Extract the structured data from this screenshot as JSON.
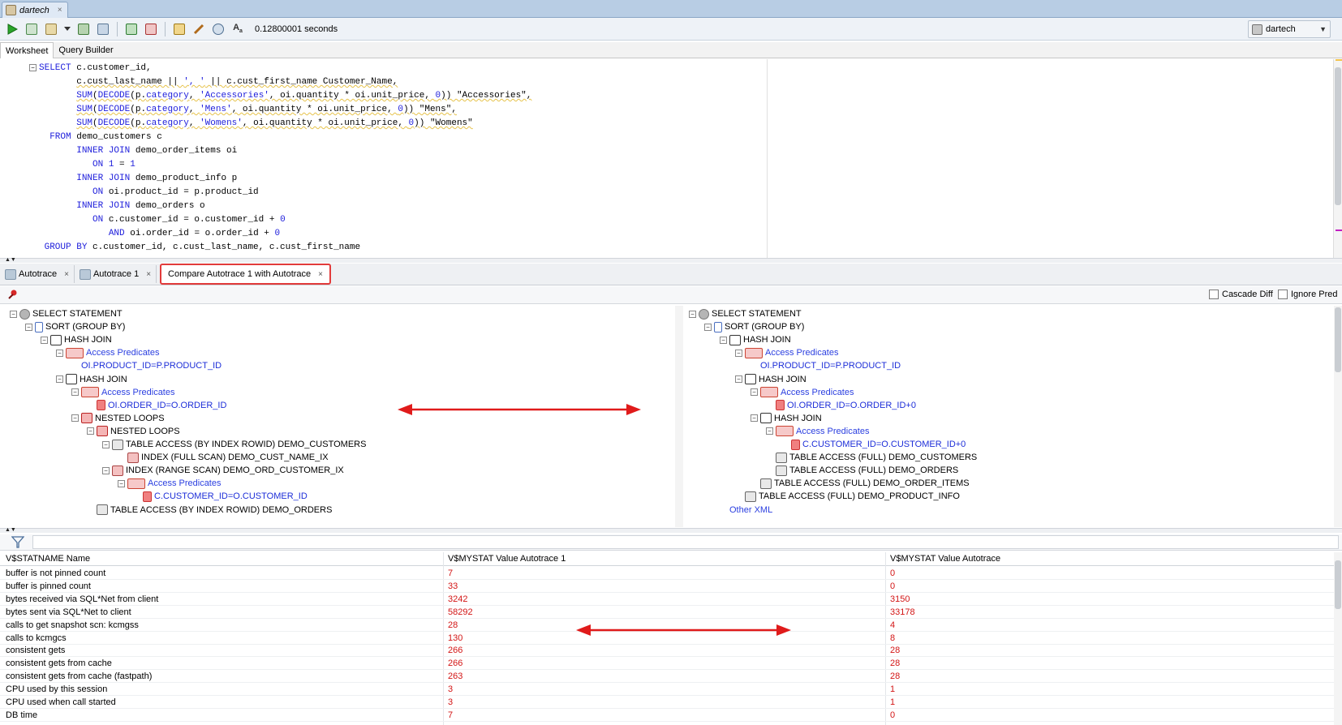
{
  "window": {
    "tab_title": "dartech",
    "tab_close": "×"
  },
  "toolbar": {
    "timing": "0.12800001 seconds",
    "connection": "dartech",
    "icons": [
      "run-statement-icon",
      "run-script-icon",
      "commit-icon",
      "rollback-icon",
      "autotrace-icon",
      "explain-plan-icon",
      "sql-tuning-icon",
      "clear-icon",
      "history-icon",
      "format-icon"
    ]
  },
  "worksheet_tabs": [
    "Worksheet",
    "Query Builder"
  ],
  "editor": {
    "lines": [
      {
        "indent": "",
        "parts": [
          [
            "kw",
            "SELECT"
          ],
          [
            "t",
            " c.customer_id,"
          ]
        ]
      },
      {
        "indent": "       ",
        "parts": [
          [
            "t",
            "c.cust_last_name || "
          ],
          [
            "str",
            "', '"
          ],
          [
            "t",
            " || "
          ],
          [
            "t",
            "c.cust_first_name Customer_Name,"
          ]
        ]
      },
      {
        "indent": "       ",
        "parts": [
          [
            "kw",
            "SUM"
          ],
          [
            "t",
            "("
          ],
          [
            "kw",
            "DECODE"
          ],
          [
            "t",
            "(p."
          ],
          [
            "kw",
            "category"
          ],
          [
            "t",
            ", "
          ],
          [
            "str",
            "'Accessories'"
          ],
          [
            "t",
            ", oi.quantity * oi.unit_price, "
          ],
          [
            "num",
            "0"
          ],
          [
            "t",
            ")) \"Accessories\","
          ]
        ]
      },
      {
        "indent": "       ",
        "parts": [
          [
            "kw",
            "SUM"
          ],
          [
            "t",
            "("
          ],
          [
            "kw",
            "DECODE"
          ],
          [
            "t",
            "(p."
          ],
          [
            "kw",
            "category"
          ],
          [
            "t",
            ", "
          ],
          [
            "str",
            "'Mens'"
          ],
          [
            "t",
            ", oi.quantity * oi.unit_price, "
          ],
          [
            "num",
            "0"
          ],
          [
            "t",
            ")) \"Mens\","
          ]
        ]
      },
      {
        "indent": "       ",
        "parts": [
          [
            "kw",
            "SUM"
          ],
          [
            "t",
            "("
          ],
          [
            "kw",
            "DECODE"
          ],
          [
            "t",
            "(p."
          ],
          [
            "kw",
            "category"
          ],
          [
            "t",
            ", "
          ],
          [
            "str",
            "'Womens'"
          ],
          [
            "t",
            ", oi.quantity * oi.unit_price, "
          ],
          [
            "num",
            "0"
          ],
          [
            "t",
            ")) \"Womens\""
          ]
        ]
      },
      {
        "indent": "  ",
        "parts": [
          [
            "kw",
            "FROM"
          ],
          [
            "t",
            " demo_customers c"
          ]
        ]
      },
      {
        "indent": "       ",
        "parts": [
          [
            "kw",
            "INNER JOIN"
          ],
          [
            "t",
            " demo_order_items oi"
          ]
        ]
      },
      {
        "indent": "          ",
        "parts": [
          [
            "kw",
            "ON"
          ],
          [
            "t",
            " "
          ],
          [
            "num",
            "1"
          ],
          [
            "t",
            " = "
          ],
          [
            "num",
            "1"
          ]
        ]
      },
      {
        "indent": "       ",
        "parts": [
          [
            "kw",
            "INNER JOIN"
          ],
          [
            "t",
            " demo_product_info p"
          ]
        ]
      },
      {
        "indent": "          ",
        "parts": [
          [
            "kw",
            "ON"
          ],
          [
            "t",
            " oi.product_id = p.product_id"
          ]
        ]
      },
      {
        "indent": "       ",
        "parts": [
          [
            "kw",
            "INNER JOIN"
          ],
          [
            "t",
            " demo_orders o"
          ]
        ]
      },
      {
        "indent": "          ",
        "parts": [
          [
            "kw",
            "ON"
          ],
          [
            "t",
            " c.customer_id = o.customer_id + "
          ],
          [
            "num",
            "0"
          ]
        ]
      },
      {
        "indent": "             ",
        "parts": [
          [
            "kw",
            "AND"
          ],
          [
            "t",
            " oi.order_id = o.order_id + "
          ],
          [
            "num",
            "0"
          ]
        ]
      },
      {
        "indent": " ",
        "parts": [
          [
            "kw",
            "GROUP BY"
          ],
          [
            "t",
            " c.customer_id, c.cust_last_name, c.cust_first_name"
          ]
        ]
      }
    ]
  },
  "result_tabs": [
    {
      "label": "Autotrace",
      "close": "×"
    },
    {
      "label": "Autotrace 1",
      "close": "×"
    },
    {
      "label": "Compare Autotrace 1 with Autotrace",
      "close": "×"
    }
  ],
  "options": {
    "cascade_diff": "Cascade Diff",
    "ignore_pred": "Ignore Pred"
  },
  "left_tree": [
    {
      "d": 0,
      "label": "SELECT STATEMENT",
      "icon": "select-statement-icon",
      "tog": "⊟"
    },
    {
      "d": 1,
      "label": "SORT (GROUP BY)",
      "icon": "sort-icon",
      "tog": "⊟"
    },
    {
      "d": 2,
      "label": "HASH JOIN",
      "icon": "hash-join-icon",
      "tog": "⊟"
    },
    {
      "d": 3,
      "label": "Access Predicates",
      "icon": "access-predicates-icon",
      "tog": "⊟",
      "cls": "pred"
    },
    {
      "d": 4,
      "label": "OI.PRODUCT_ID=P.PRODUCT_ID",
      "icon": "",
      "cls": "blue"
    },
    {
      "d": 3,
      "label": "HASH JOIN",
      "icon": "hash-join-icon",
      "tog": "⊟"
    },
    {
      "d": 4,
      "label": "Access Predicates",
      "icon": "access-predicates-icon",
      "tog": "⊟",
      "cls": "pred"
    },
    {
      "d": 5,
      "label": "OI.ORDER_ID=O.ORDER_ID",
      "icon": "predicate-icon",
      "cls": "blue"
    },
    {
      "d": 4,
      "label": "NESTED LOOPS",
      "icon": "nested-loops-icon",
      "tog": "⊟"
    },
    {
      "d": 5,
      "label": "NESTED LOOPS",
      "icon": "nested-loops-icon",
      "tog": "⊟"
    },
    {
      "d": 6,
      "label": "TABLE ACCESS (BY INDEX ROWID) DEMO_CUSTOMERS",
      "icon": "table-icon",
      "tog": "⊟"
    },
    {
      "d": 7,
      "label": "INDEX (FULL SCAN) DEMO_CUST_NAME_IX",
      "icon": "index-icon"
    },
    {
      "d": 6,
      "label": "INDEX (RANGE SCAN) DEMO_ORD_CUSTOMER_IX",
      "icon": "index-icon",
      "tog": "⊟"
    },
    {
      "d": 7,
      "label": "Access Predicates",
      "icon": "access-predicates-icon",
      "tog": "⊟",
      "cls": "pred"
    },
    {
      "d": 8,
      "label": "C.CUSTOMER_ID=O.CUSTOMER_ID",
      "icon": "predicate-icon",
      "cls": "blue"
    },
    {
      "d": 5,
      "label": "TABLE ACCESS (BY INDEX ROWID) DEMO_ORDERS",
      "icon": "table-icon"
    }
  ],
  "right_tree": [
    {
      "d": 0,
      "label": "SELECT STATEMENT",
      "icon": "select-statement-icon",
      "tog": "⊟"
    },
    {
      "d": 1,
      "label": "SORT (GROUP BY)",
      "icon": "sort-icon",
      "tog": "⊟"
    },
    {
      "d": 2,
      "label": "HASH JOIN",
      "icon": "hash-join-icon",
      "tog": "⊟"
    },
    {
      "d": 3,
      "label": "Access Predicates",
      "icon": "access-predicates-icon",
      "tog": "⊟",
      "cls": "pred"
    },
    {
      "d": 4,
      "label": "OI.PRODUCT_ID=P.PRODUCT_ID",
      "icon": "",
      "cls": "blue"
    },
    {
      "d": 3,
      "label": "HASH JOIN",
      "icon": "hash-join-icon",
      "tog": "⊟"
    },
    {
      "d": 4,
      "label": "Access Predicates",
      "icon": "access-predicates-icon",
      "tog": "⊟",
      "cls": "pred"
    },
    {
      "d": 5,
      "label": "OI.ORDER_ID=O.ORDER_ID+0",
      "icon": "predicate-icon",
      "cls": "blue"
    },
    {
      "d": 4,
      "label": "HASH JOIN",
      "icon": "hash-join-icon",
      "tog": "⊟"
    },
    {
      "d": 5,
      "label": "Access Predicates",
      "icon": "access-predicates-icon",
      "tog": "⊟",
      "cls": "pred"
    },
    {
      "d": 6,
      "label": "C.CUSTOMER_ID=O.CUSTOMER_ID+0",
      "icon": "predicate-icon",
      "cls": "blue"
    },
    {
      "d": 5,
      "label": "TABLE ACCESS (FULL) DEMO_CUSTOMERS",
      "icon": "table-icon"
    },
    {
      "d": 5,
      "label": "TABLE ACCESS (FULL) DEMO_ORDERS",
      "icon": "table-icon"
    },
    {
      "d": 4,
      "label": "TABLE ACCESS (FULL) DEMO_ORDER_ITEMS",
      "icon": "table-icon"
    },
    {
      "d": 3,
      "label": "TABLE ACCESS (FULL) DEMO_PRODUCT_INFO",
      "icon": "table-icon"
    },
    {
      "d": 2,
      "label": "Other XML",
      "icon": "",
      "cls": "pred"
    }
  ],
  "stats": {
    "headers": [
      "V$STATNAME Name",
      "V$MYSTAT Value Autotrace 1",
      "V$MYSTAT Value Autotrace"
    ],
    "rows": [
      [
        "buffer is not pinned count",
        "7",
        "0"
      ],
      [
        "buffer is pinned count",
        "33",
        "0"
      ],
      [
        "bytes received via SQL*Net from client",
        "3242",
        "3150"
      ],
      [
        "bytes sent via SQL*Net to client",
        "58292",
        "33178"
      ],
      [
        "calls to get snapshot scn: kcmgss",
        "28",
        "4"
      ],
      [
        "calls to kcmgcs",
        "130",
        "8"
      ],
      [
        "consistent gets",
        "266",
        "28"
      ],
      [
        "consistent gets from cache",
        "266",
        "28"
      ],
      [
        "consistent gets from cache (fastpath)",
        "263",
        "28"
      ],
      [
        "CPU used by this session",
        "3",
        "1"
      ],
      [
        "CPU used when call started",
        "3",
        "1"
      ],
      [
        "DB time",
        "7",
        "0"
      ]
    ]
  },
  "colors": {
    "diff_value": "#d31515",
    "highlight": "#e23b3b",
    "keyword": "#1d1ddb"
  }
}
